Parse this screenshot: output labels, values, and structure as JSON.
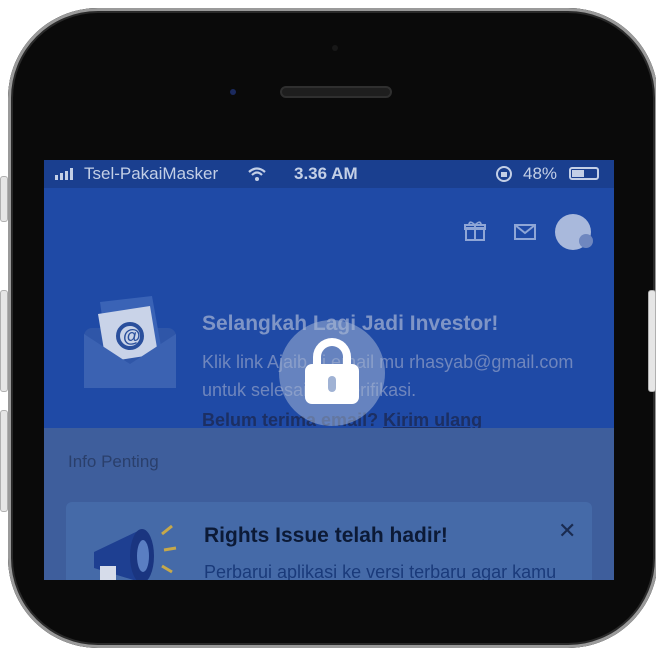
{
  "status_bar": {
    "carrier": "Tsel-PakaiMasker",
    "time": "3.36 AM",
    "battery": "48%"
  },
  "header": {
    "icons": [
      "gift-icon",
      "mail-icon",
      "avatar"
    ]
  },
  "verification_banner": {
    "title": "Selangkah Lagi Jadi Investor!",
    "line1": "Klik link Ajaib di email mu rhasyab@gmail.com",
    "line2": "untuk selesaikan verifikasi.",
    "resend_prefix": "Belum terima email? ",
    "resend_link": "Kirim ulang"
  },
  "info": {
    "heading": "Info Penting"
  },
  "announcement_card": {
    "title": "Rights Issue telah hadir!",
    "description": "Perbarui aplikasi ke versi terbaru agar kamu",
    "close_symbol": "✕"
  },
  "lock_overlay": {
    "icon": "lock-icon"
  },
  "colors": {
    "header_bg": "#1f4aa6",
    "status_bg": "#1a3f8f",
    "overlay_tint": "#3e5e9c"
  }
}
